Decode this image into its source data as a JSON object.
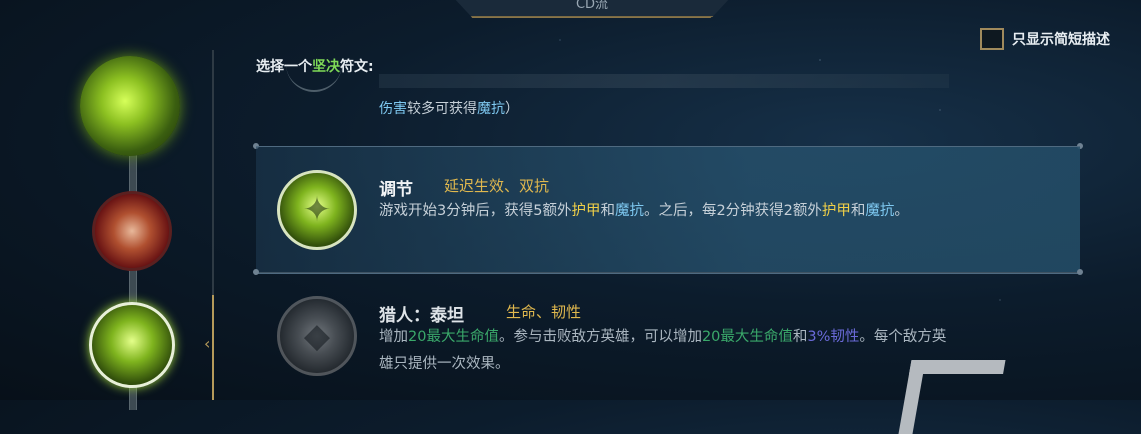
{
  "header": {
    "tab_title": "CD流"
  },
  "filter": {
    "checkbox_label": "只显示简短描述",
    "checked": false
  },
  "prompt": {
    "before": "选择一个",
    "highlight": "坚决",
    "after": "符文:"
  },
  "partial_row": {
    "text_a": "伤害",
    "text_b": "较多可获得",
    "text_c": "魔抗",
    "text_d": "）"
  },
  "runes": [
    {
      "name": "调节",
      "tags": "延迟生效、双抗",
      "icon": "adaptation-muscle-icon",
      "selected": true,
      "desc": {
        "p1": "游戏开始3分钟后，获得5额外",
        "h1": "护甲",
        "p2": "和",
        "h2": "魔抗",
        "p3": "。之后，每2分钟获得2额外",
        "h3": "护甲",
        "p4": "和",
        "h4": "魔抗",
        "p5": "。"
      }
    },
    {
      "name": "猎人：泰坦",
      "tags": "生命、韧性",
      "icon": "titan-rhino-icon",
      "selected": false,
      "desc": {
        "p1": "增加",
        "h1": "20最大生命值",
        "p2": "。参与击败敌方英雄，可以增加",
        "h2": "20最大生命值",
        "p3": "和",
        "h3": "3%韧性",
        "p4": "。每个敌方英雄只提供一次效果。"
      }
    }
  ],
  "colors": {
    "gold": "#f0d048",
    "blue": "#7ec8f0",
    "green": "#3aa86a",
    "purple": "#6a6ad8",
    "tag": "#e0b84e"
  }
}
